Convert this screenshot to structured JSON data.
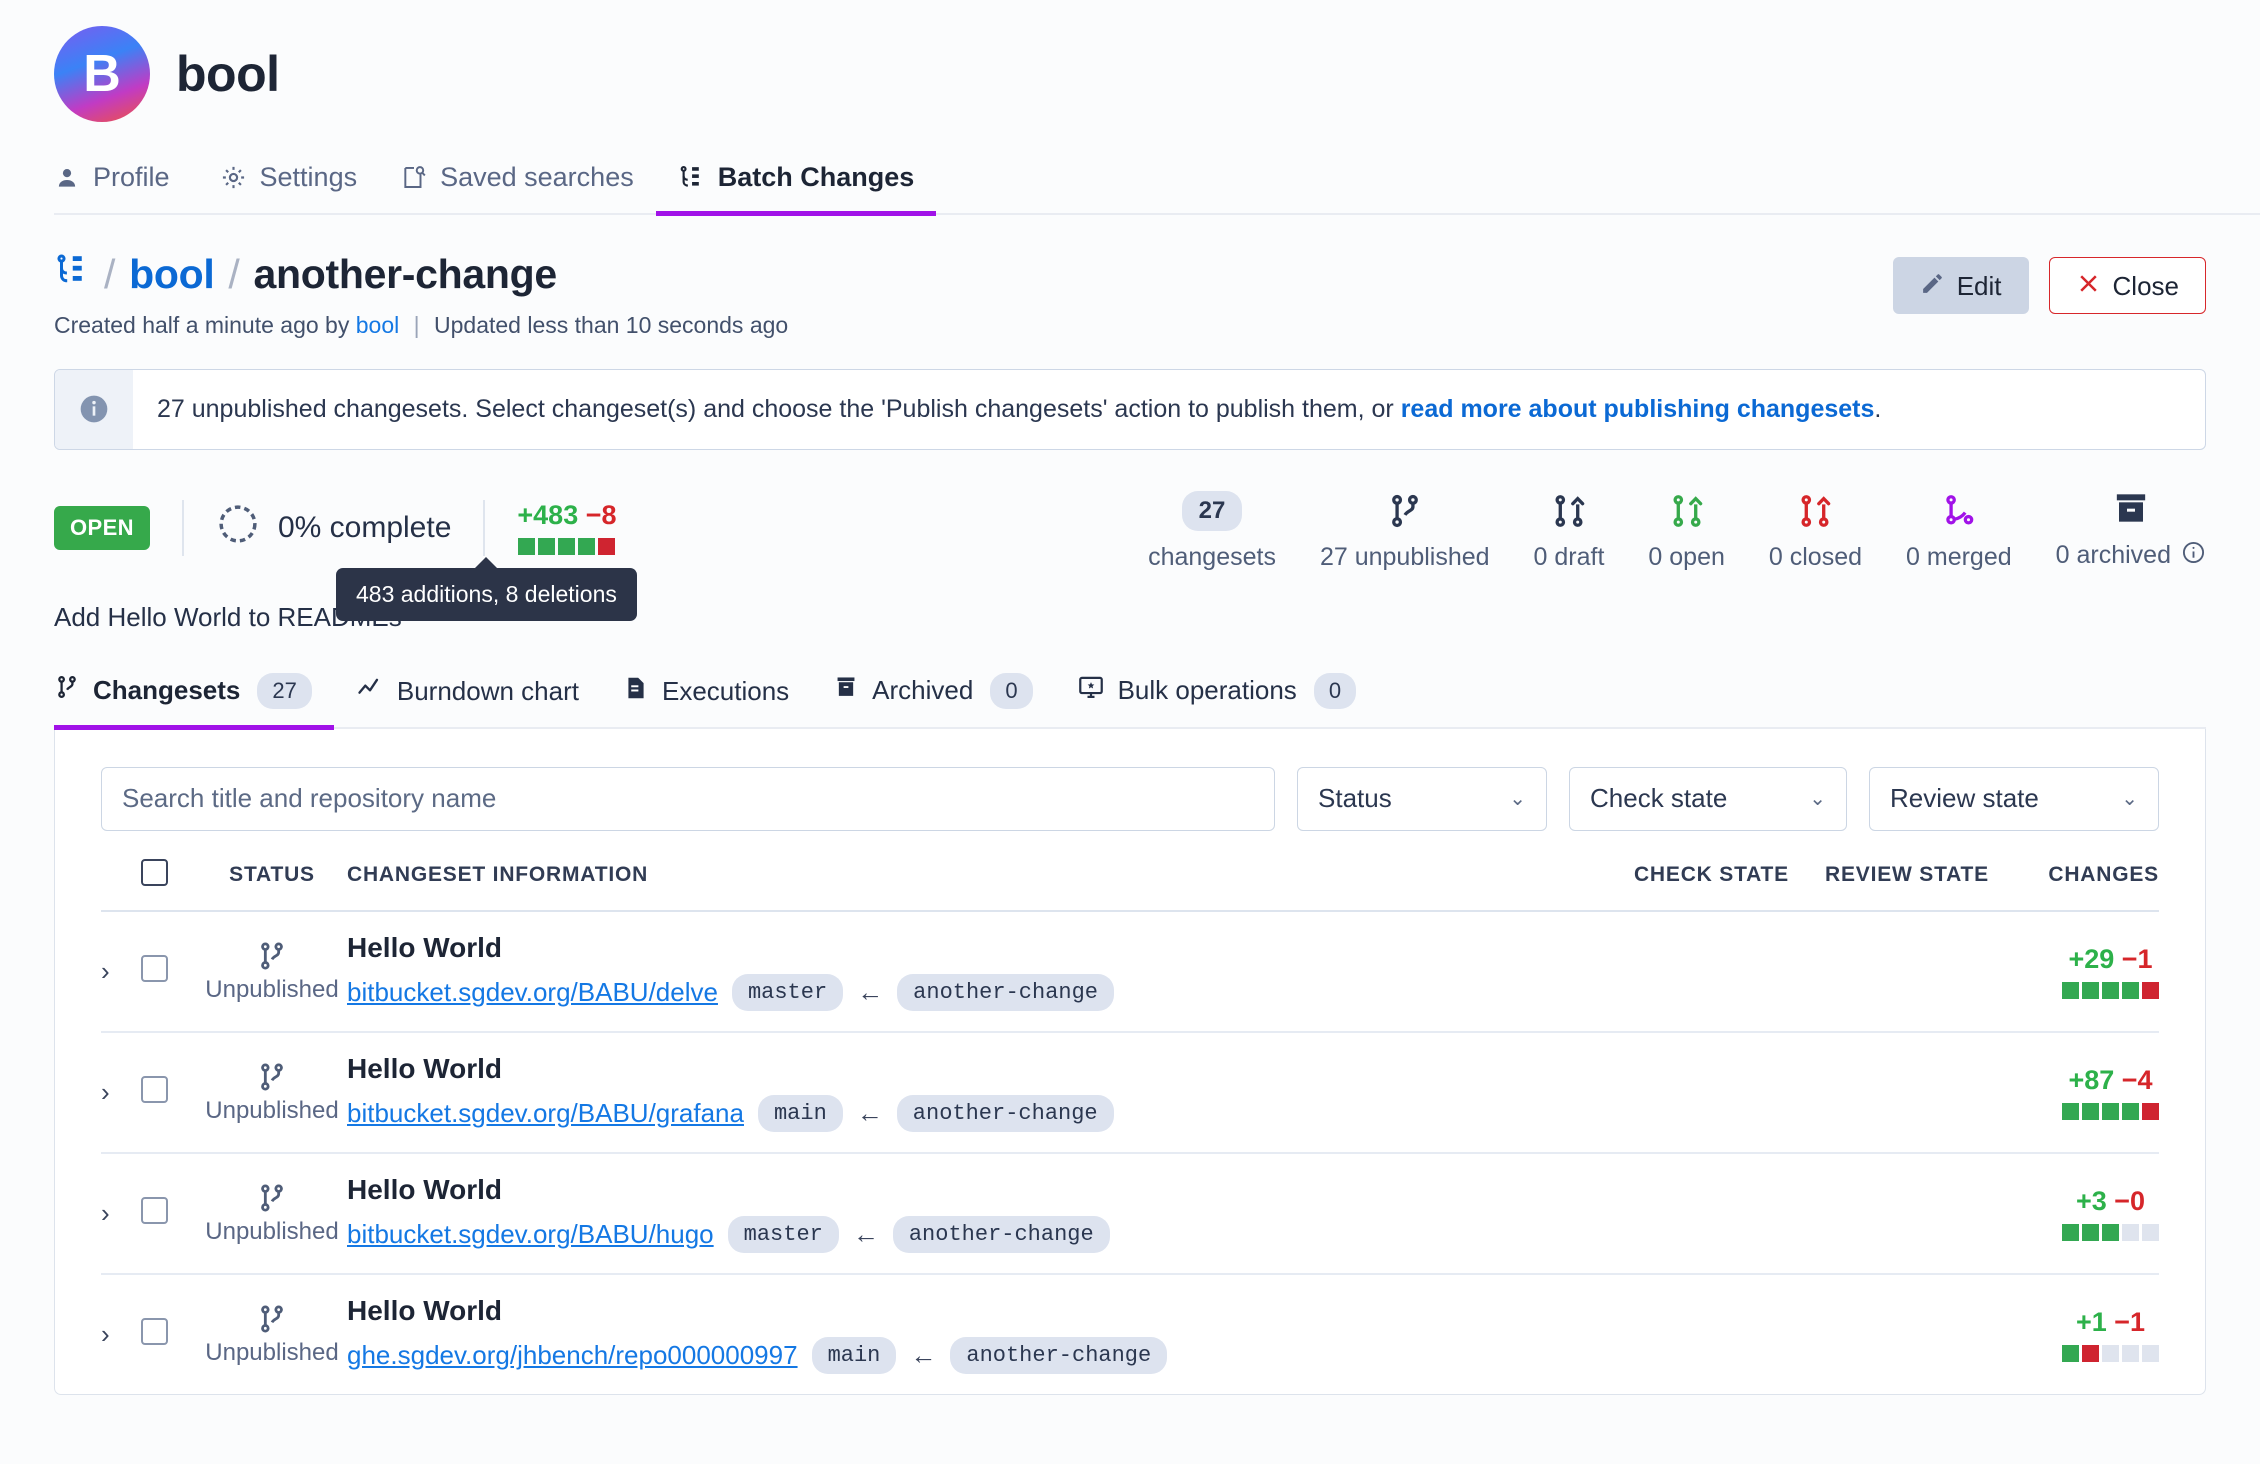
{
  "user": {
    "name": "bool",
    "avatar_initial": "B"
  },
  "nav_tabs": [
    {
      "label": "Profile",
      "icon": "person-icon",
      "active": false
    },
    {
      "label": "Settings",
      "icon": "gear-icon",
      "active": false
    },
    {
      "label": "Saved searches",
      "icon": "saved-search-icon",
      "active": false
    },
    {
      "label": "Batch Changes",
      "icon": "batch-changes-icon",
      "active": true
    }
  ],
  "breadcrumb": {
    "icon": "batch-changes-icon",
    "namespace": "bool",
    "name": "another-change",
    "separator": "/",
    "created_prefix": "Created half a minute ago by",
    "created_by": "bool",
    "divider": "|",
    "updated": "Updated less than 10 seconds ago"
  },
  "actions": {
    "edit_label": "Edit",
    "edit_icon": "pencil-icon",
    "close_label": "Close",
    "close_icon": "x-icon"
  },
  "banner": {
    "icon": "info-icon",
    "text_before": "27 unpublished changesets. Select changeset(s) and choose the 'Publish changesets' action to publish them, or ",
    "link_text": "read more about publishing changesets",
    "text_after": "."
  },
  "stats": {
    "state_badge": "OPEN",
    "progress_icon": "progress-check-icon",
    "progress_label": "0% complete",
    "diff_added": "+483",
    "diff_deleted": "−8",
    "diff_squares": [
      "g",
      "g",
      "g",
      "g",
      "r"
    ],
    "tooltip": "483 additions, 8 deletions",
    "counts": [
      {
        "name": "changesets",
        "value": "27",
        "label": "changesets",
        "icon": "pill-count",
        "color": "#2b3750"
      },
      {
        "name": "unpublished",
        "value": "27",
        "label": "27 unpublished",
        "icon": "unpublished-branch-icon",
        "color": "#2b3750"
      },
      {
        "name": "draft",
        "value": "0",
        "label": "0 draft",
        "icon": "draft-pr-icon",
        "color": "#2b3750"
      },
      {
        "name": "open",
        "value": "0",
        "label": "0 open",
        "icon": "open-pr-icon",
        "color": "#36a94b"
      },
      {
        "name": "closed",
        "value": "0",
        "label": "0 closed",
        "icon": "closed-pr-icon",
        "color": "#d6262a"
      },
      {
        "name": "merged",
        "value": "0",
        "label": "0 merged",
        "icon": "merged-pr-icon",
        "color": "#a112e8"
      },
      {
        "name": "archived",
        "value": "0",
        "label": "0 archived",
        "icon": "archive-icon",
        "color": "#2b3750"
      }
    ],
    "archived_info_icon": "info-circle-icon",
    "description": "Add Hello World to READMEs"
  },
  "subtabs": [
    {
      "label": "Changesets",
      "count": "27",
      "icon": "branch-icon",
      "active": true
    },
    {
      "label": "Burndown chart",
      "count": null,
      "icon": "line-chart-icon",
      "active": false
    },
    {
      "label": "Executions",
      "count": null,
      "icon": "file-document-icon",
      "active": false
    },
    {
      "label": "Archived",
      "count": "0",
      "icon": "archive-icon",
      "active": false
    },
    {
      "label": "Bulk operations",
      "count": "0",
      "icon": "monitor-star-icon",
      "active": false
    }
  ],
  "filters": {
    "search_placeholder": "Search title and repository name",
    "search_value": "",
    "status_label": "Status",
    "check_state_label": "Check state",
    "review_state_label": "Review state",
    "chevron": "⌄"
  },
  "table": {
    "headers": {
      "status": "STATUS",
      "changeset_information": "CHANGESET INFORMATION",
      "check_state": "CHECK STATE",
      "review_state": "REVIEW STATE",
      "changes": "CHANGES"
    },
    "rows": [
      {
        "status": "Unpublished",
        "status_icon": "unpublished-branch-icon",
        "title": "Hello World",
        "repo": "bitbucket.sgdev.org/BABU/delve",
        "base_branch": "master",
        "arrow": "←",
        "head_branch": "another-change",
        "check_state": "",
        "review_state": "",
        "added": "+29",
        "deleted": "−1",
        "squares": [
          "g",
          "g",
          "g",
          "g",
          "r"
        ]
      },
      {
        "status": "Unpublished",
        "status_icon": "unpublished-branch-icon",
        "title": "Hello World",
        "repo": "bitbucket.sgdev.org/BABU/grafana",
        "base_branch": "main",
        "arrow": "←",
        "head_branch": "another-change",
        "check_state": "",
        "review_state": "",
        "added": "+87",
        "deleted": "−4",
        "squares": [
          "g",
          "g",
          "g",
          "g",
          "r"
        ]
      },
      {
        "status": "Unpublished",
        "status_icon": "unpublished-branch-icon",
        "title": "Hello World",
        "repo": "bitbucket.sgdev.org/BABU/hugo",
        "base_branch": "master",
        "arrow": "←",
        "head_branch": "another-change",
        "check_state": "",
        "review_state": "",
        "added": "+3",
        "deleted": "−0",
        "squares": [
          "g",
          "g",
          "g",
          "n",
          "n"
        ]
      },
      {
        "status": "Unpublished",
        "status_icon": "unpublished-branch-icon",
        "title": "Hello World",
        "repo": "ghe.sgdev.org/jhbench/repo000000997",
        "base_branch": "main",
        "arrow": "←",
        "head_branch": "another-change",
        "check_state": "",
        "review_state": "",
        "added": "+1",
        "deleted": "−1",
        "squares": [
          "g",
          "r",
          "n",
          "n",
          "n"
        ]
      }
    ]
  }
}
